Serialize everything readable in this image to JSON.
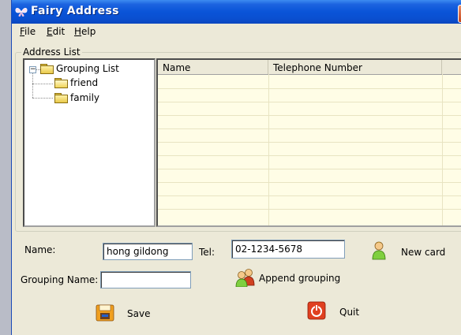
{
  "window": {
    "title": "Fairy Address"
  },
  "menu": [
    {
      "label": "File",
      "mnemonic": "F",
      "rest": "ile"
    },
    {
      "label": "Edit",
      "mnemonic": "E",
      "rest": "dit"
    },
    {
      "label": "Help",
      "mnemonic": "H",
      "rest": "elp"
    }
  ],
  "address_list": {
    "label": "Address List",
    "tree": {
      "root": "Grouping List",
      "children": [
        "friend",
        "family"
      ]
    },
    "columns": [
      "Name",
      "Telephone Number"
    ]
  },
  "form": {
    "name_label": "Name:",
    "name_value": "hong gildong",
    "tel_label": "Tel:",
    "tel_value": "02-1234-5678",
    "grouping_label": "Grouping Name:",
    "grouping_value": ""
  },
  "buttons": {
    "new_card": "New card",
    "append_grouping": "Append grouping",
    "save": "Save",
    "quit": "Quit"
  },
  "colors": {
    "titlebar": "#0a54d8",
    "list_background": "#fffde6",
    "window_face": "#ece9d8"
  }
}
